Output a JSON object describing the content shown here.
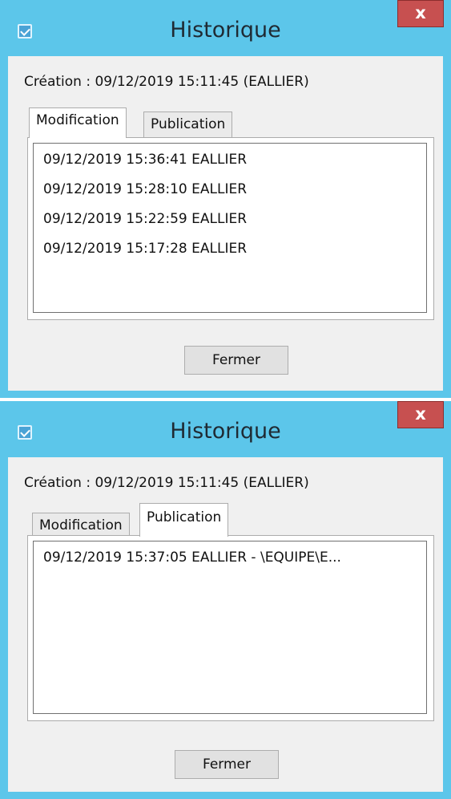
{
  "windows": [
    {
      "title": "Historique",
      "close_label": "x",
      "creation": "Création : 09/12/2019 15:11:45 (EALLIER)",
      "tabs": [
        {
          "label": "Modification",
          "active": true
        },
        {
          "label": "Publication",
          "active": false
        }
      ],
      "list_items": [
        "09/12/2019 15:36:41 EALLIER",
        "09/12/2019 15:28:10 EALLIER",
        "09/12/2019 15:22:59 EALLIER",
        "09/12/2019 15:17:28 EALLIER"
      ],
      "close_button_label": "Fermer"
    },
    {
      "title": "Historique",
      "close_label": "x",
      "creation": "Création : 09/12/2019 15:11:45 (EALLIER)",
      "tabs": [
        {
          "label": "Modification",
          "active": false
        },
        {
          "label": "Publication",
          "active": true
        }
      ],
      "list_items": [
        "09/12/2019 15:37:05 EALLIER - \\EQUIPE\\E..."
      ],
      "close_button_label": "Fermer"
    }
  ],
  "colors": {
    "titlebar": "#5cc6ea",
    "close_button": "#c75050",
    "client_background": "#f0f0f0"
  }
}
